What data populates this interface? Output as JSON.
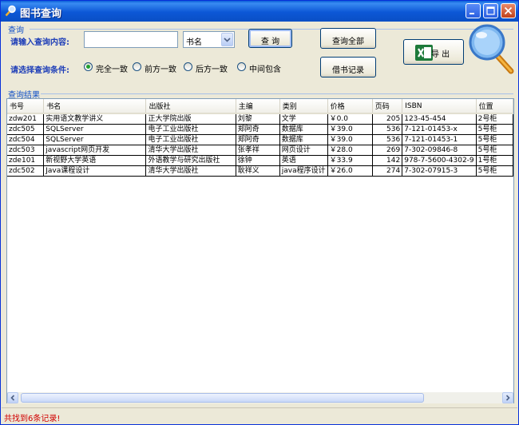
{
  "window": {
    "title": "图书查询"
  },
  "query_group": {
    "label": "查询"
  },
  "search": {
    "content_label": "请输入查询内容:",
    "value": "",
    "field_selected": "书名",
    "condition_label": "请选择查询条件:",
    "conditions": [
      "完全一致",
      "前方一致",
      "后方一致",
      "中间包含"
    ],
    "selected_condition": "完全一致"
  },
  "buttons": {
    "query": "查 询",
    "query_all": "查询全部",
    "borrow_records": "借书记录",
    "export": "导 出"
  },
  "results": {
    "label": "查询结果",
    "columns": [
      "书号",
      "书名",
      "出版社",
      "主编",
      "类别",
      "价格",
      "页码",
      "ISBN",
      "位置"
    ],
    "rows": [
      [
        "zdw201",
        "实用语文教学讲义",
        "正大学院出版",
        "刘黎",
        "文学",
        "￥0.0",
        "205",
        "123-45-454",
        "2号柜"
      ],
      [
        "zdc505",
        "SQLServer",
        "电子工业出版社",
        "郑阿奇",
        "数据库",
        "￥39.0",
        "536",
        "7-121-01453-x",
        "5号柜"
      ],
      [
        "zdc504",
        "SQLServer",
        "电子工业出版社",
        "郑阿奇",
        "数据库",
        "￥39.0",
        "536",
        "7-121-01453-1",
        "5号柜"
      ],
      [
        "zdc503",
        "javascript网页开发",
        "清华大学出版社",
        "张孝祥",
        "网页设计",
        "￥28.0",
        "269",
        "7-302-09846-8",
        "5号柜"
      ],
      [
        "zde101",
        "新视野大学英语",
        "外语教学与研究出版社",
        "徐钟",
        "英语",
        "￥33.9",
        "142",
        "978-7-5600-4302-9",
        "1号柜"
      ],
      [
        "zdc502",
        "Java课程设计",
        "清华大学出版社",
        "耿祥义",
        "java程序设计",
        "￥26.0",
        "274",
        "7-302-07915-3",
        "5号柜"
      ]
    ]
  },
  "status": {
    "text": "共找到6条记录!"
  },
  "colors": {
    "title_bar": "#0a56d4",
    "label_blue": "#1f3fb8",
    "status_red": "#d00000"
  }
}
